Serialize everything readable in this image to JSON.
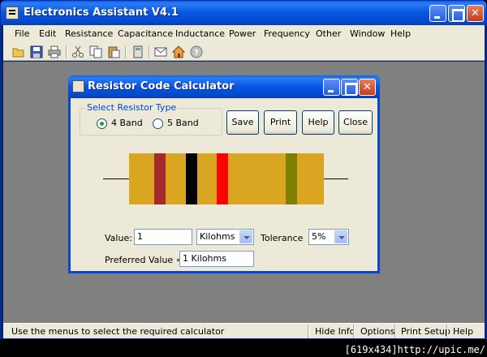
{
  "app": {
    "title": "Electronics Assistant V4.1"
  },
  "menu": [
    "File",
    "Edit",
    "Resistance",
    "Capacitance",
    "Inductance",
    "Power",
    "Frequency",
    "Other",
    "Window",
    "Help"
  ],
  "toolbar": {
    "icons": [
      "open-folder-icon",
      "save-disk-icon",
      "print-icon",
      "cut-icon",
      "copy-icon",
      "paste-icon",
      "calculator-icon",
      "email-icon",
      "home-icon",
      "help-icon"
    ]
  },
  "dialog": {
    "title": "Resistor Code Calculator",
    "group_label": "Select Resistor Type",
    "option_4band": "4 Band",
    "option_5band": "5 Band",
    "selected_type": "4 Band",
    "buttons": {
      "save": "Save",
      "print": "Print",
      "help": "Help",
      "close": "Close"
    },
    "value_label": "Value:",
    "value": "1",
    "unit": "Kilohms",
    "tolerance_label": "Tolerance",
    "tolerance": "5%",
    "preferred_label": "Preferred Value =",
    "preferred_value": "1 Kilohms",
    "body_color": "#daa520",
    "band_colors": [
      "#a52a2a",
      "#000000",
      "#ff0000",
      "#808000"
    ]
  },
  "status": {
    "message": "Use the menus to select the required calculator",
    "hide_info": "Hide Info",
    "options": "Options",
    "print_setup": "Print Setup",
    "help": "Help"
  },
  "watermark": "[619x434]http://upic.me/"
}
